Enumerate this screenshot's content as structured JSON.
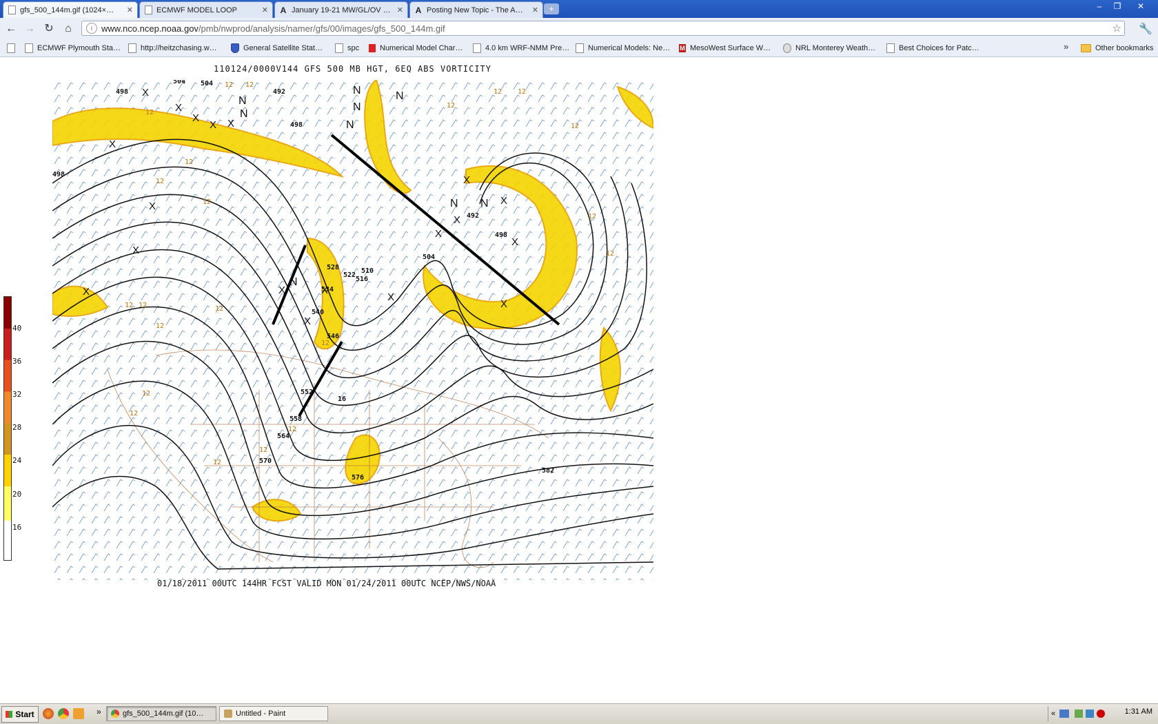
{
  "browser": {
    "tabs": [
      {
        "title": "gfs_500_144m.gif (1024×…",
        "icon": "page-icon",
        "active": true
      },
      {
        "title": "ECMWF MODEL LOOP",
        "icon": "page-icon",
        "active": false
      },
      {
        "title": "January 19-21 MW/GL/OV …",
        "icon": "a-icon",
        "active": false
      },
      {
        "title": "Posting New Topic - The A…",
        "icon": "a-icon",
        "active": false
      }
    ],
    "new_tab": "+",
    "url_host": "www.nco.ncep.noaa.gov",
    "url_path": "/pmb/nwprod/analysis/namer/gfs/00/images/gfs_500_144m.gif",
    "window_buttons": {
      "minimize": "‒",
      "restore": "❐",
      "close": "✕"
    }
  },
  "bookmarks": {
    "items": [
      {
        "label": "",
        "icon": "page-icon"
      },
      {
        "label": "ECMWF Plymouth Sta…",
        "icon": "page-icon"
      },
      {
        "label": "http://heitzchasing.w…",
        "icon": "page-icon"
      },
      {
        "label": "General Satellite Stat…",
        "icon": "shield-icon"
      },
      {
        "label": "spc",
        "icon": "page-icon"
      },
      {
        "label": "Numerical Model Char…",
        "icon": "maple-leaf-icon"
      },
      {
        "label": "4.0 km WRF-NMM Pre…",
        "icon": "page-icon"
      },
      {
        "label": "Numerical Models: Ne…",
        "icon": "page-icon"
      },
      {
        "label": "MesoWest Surface W…",
        "icon": "m-icon"
      },
      {
        "label": "NRL Monterey Weath…",
        "icon": "globe-icon"
      },
      {
        "label": "Best Choices for Patc…",
        "icon": "page-icon"
      }
    ],
    "more": "»",
    "other": "Other bookmarks"
  },
  "map": {
    "title": "110124/0000V144 GFS 500 MB HGT, 6EQ ABS VORTICITY",
    "footer": "01/18/2011 00UTC 144HR FCST VALID MON 01/24/2011 00UTC  NCEP/NWS/NOAA",
    "colorbar_labels": [
      "40",
      "36",
      "32",
      "28",
      "24",
      "20",
      "16"
    ],
    "colorbar_colors": [
      "#8b0000",
      "#c81e1e",
      "#e8501e",
      "#f08a28",
      "#d2961e",
      "#ffd200",
      "#ffff64",
      "#ffffff"
    ],
    "contour_labels": [
      "504",
      "492",
      "498",
      "498",
      "504",
      "510",
      "516",
      "522",
      "528",
      "534",
      "540",
      "546",
      "552",
      "558",
      "564",
      "570",
      "576",
      "582",
      "498",
      "492",
      "498",
      "504"
    ],
    "vort_labels": [
      "12",
      "12",
      "12",
      "12",
      "12",
      "12",
      "12",
      "12",
      "12",
      "12",
      "12",
      "12",
      "12",
      "12",
      "12",
      "12",
      "12",
      "12",
      "12",
      "12",
      "12",
      "12"
    ],
    "min_markers": [
      "N",
      "N",
      "N",
      "N",
      "N",
      "N",
      "N",
      "N",
      "N"
    ],
    "max_markers": [
      "X",
      "X",
      "X",
      "X",
      "X",
      "X",
      "X",
      "X",
      "X",
      "X",
      "X",
      "X",
      "X",
      "X",
      "X",
      "X",
      "X",
      "X",
      "X"
    ],
    "vort_value": "16"
  },
  "taskbar": {
    "start": "Start",
    "chevron": "»",
    "tasks": [
      {
        "label": "gfs_500_144m.gif (10…",
        "active": true
      },
      {
        "label": "Untitled - Paint",
        "active": false
      }
    ],
    "tray_chevron": "«",
    "clock": "1:31 AM"
  }
}
